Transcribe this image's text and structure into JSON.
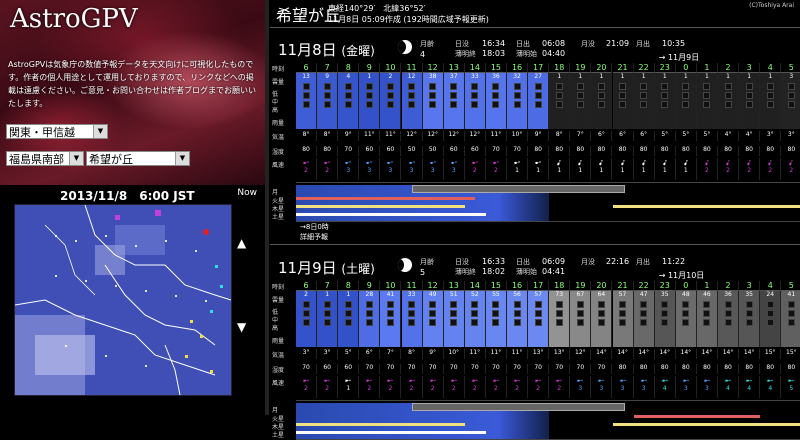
{
  "left": {
    "logo": "AstroGPV",
    "intro": "AstroGPVは気象庁の数値予報データを天文向けに可視化したものです。作者の個人用途として運用しておりますので、リンクなどへの掲載は遠慮ください。ご意見・お問い合わせは作者ブログまでお願いいたします。",
    "region_select": "関東・甲信越",
    "pref_select": "福島県南部",
    "site_select": "希望が丘",
    "map_time": "2013/11/8　6:00 JST",
    "now_label": "Now",
    "up_arrow": "▲",
    "down_arrow": "▼"
  },
  "header": {
    "site": "希望が丘",
    "coord": "東経140°29′　北緯36°52′",
    "made": "11月8日 05:09作成 (192時間広域予報更新)",
    "copyright": "(C)Toshiya Arai"
  },
  "row_labels": {
    "time": "時刻",
    "cloud_total": "雲量",
    "cloud_low": "低",
    "cloud_mid": "中",
    "cloud_high": "高",
    "rain": "雨量",
    "temp": "気温",
    "humidity": "湿度",
    "wind": "風速",
    "moon": "月",
    "mars": "火星",
    "jupiter": "木星",
    "saturn": "土星"
  },
  "days": [
    {
      "date": "11月8日",
      "dow": "(金曜)",
      "moon_age_label": "月齢",
      "moon_age": "4",
      "sunset_label": "日没",
      "sunset": "16:34",
      "civil_end_label": "薄明終",
      "civil_end": "18:03",
      "sunrise_label": "日出",
      "sunrise": "06:08",
      "civil_start_label": "薄明始",
      "civil_start": "04:40",
      "moonset_label": "月没",
      "moonset": "21:09",
      "moonrise_label": "月出",
      "moonrise": "10:35",
      "next_day": "11月9日",
      "hours": [
        "6",
        "7",
        "8",
        "9",
        "10",
        "11",
        "12",
        "13",
        "14",
        "15",
        "16",
        "17",
        "18",
        "19",
        "20",
        "21",
        "22",
        "23",
        "0",
        "1",
        "2",
        "3",
        "4",
        "5"
      ],
      "cloud": [
        "13",
        "9",
        "4",
        "1",
        "2",
        "12",
        "38",
        "37",
        "33",
        "36",
        "32",
        "27",
        "1",
        "1",
        "1",
        "1",
        "1",
        "1",
        "1",
        "1",
        "1",
        "1",
        "1",
        "3"
      ],
      "temp": [
        "8°",
        "8°",
        "9°",
        "11°",
        "11°",
        "12°",
        "12°",
        "12°",
        "12°",
        "11°",
        "10°",
        "9°",
        "8°",
        "7°",
        "6°",
        "6°",
        "6°",
        "5°",
        "5°",
        "5°",
        "4°",
        "4°",
        "3°",
        "3°"
      ],
      "hum": [
        "80",
        "80",
        "70",
        "60",
        "60",
        "50",
        "50",
        "60",
        "60",
        "70",
        "70",
        "80",
        "80",
        "80",
        "80",
        "80",
        "80",
        "80",
        "80",
        "80",
        "80",
        "80",
        "80",
        "80"
      ],
      "wind_speed": [
        "2",
        "2",
        "3",
        "3",
        "3",
        "3",
        "3",
        "3",
        "2",
        "2",
        "1",
        "1",
        "1",
        "1",
        "1",
        "1",
        "1",
        "1",
        "1",
        "2",
        "2",
        "2",
        "2",
        "2"
      ],
      "wind_color": [
        "#d23ad2",
        "#d23ad2",
        "#5aa0ff",
        "#5aa0ff",
        "#5aa0ff",
        "#5aa0ff",
        "#5aa0ff",
        "#5aa0ff",
        "#d23ad2",
        "#d23ad2",
        "#ffffff",
        "#ffffff",
        "#ffffff",
        "#ffffff",
        "#ffffff",
        "#ffffff",
        "#ffffff",
        "#ffffff",
        "#ffffff",
        "#d23ad2",
        "#d23ad2",
        "#d23ad2",
        "#d23ad2",
        "#d23ad2"
      ],
      "moon_note1": "→8日0時",
      "moon_note2": "詳細予報"
    },
    {
      "date": "11月9日",
      "dow": "(土曜)",
      "moon_age_label": "月齢",
      "moon_age": "5",
      "sunset_label": "日没",
      "sunset": "16:33",
      "civil_end_label": "薄明終",
      "civil_end": "18:02",
      "sunrise_label": "日出",
      "sunrise": "06:09",
      "civil_start_label": "薄明始",
      "civil_start": "04:41",
      "moonset_label": "月没",
      "moonset": "22:16",
      "moonrise_label": "月出",
      "moonrise": "11:22",
      "next_day": "11月10日",
      "hours": [
        "6",
        "7",
        "8",
        "9",
        "10",
        "11",
        "12",
        "13",
        "14",
        "15",
        "16",
        "17",
        "18",
        "19",
        "20",
        "21",
        "22",
        "23",
        "0",
        "1",
        "2",
        "3",
        "4",
        "5"
      ],
      "cloud": [
        "2",
        "1",
        "1",
        "28",
        "41",
        "33",
        "49",
        "51",
        "52",
        "55",
        "56",
        "57",
        "73",
        "67",
        "64",
        "57",
        "47",
        "35",
        "48",
        "46",
        "36",
        "35",
        "24",
        "41"
      ],
      "temp": [
        "3°",
        "3°",
        "5°",
        "6°",
        "7°",
        "8°",
        "9°",
        "10°",
        "11°",
        "11°",
        "11°",
        "13°",
        "13°",
        "12°",
        "14°",
        "14°",
        "14°",
        "14°",
        "14°",
        "14°",
        "14°",
        "14°",
        "15°",
        "15°"
      ],
      "hum": [
        "70",
        "60",
        "60",
        "70",
        "70",
        "70",
        "70",
        "70",
        "70",
        "70",
        "70",
        "70",
        "70",
        "70",
        "70",
        "80",
        "80",
        "80",
        "80",
        "80",
        "80",
        "80",
        "80",
        "80"
      ],
      "wind_speed": [
        "2",
        "2",
        "1",
        "2",
        "2",
        "2",
        "2",
        "2",
        "2",
        "2",
        "2",
        "2",
        "2",
        "3",
        "3",
        "3",
        "3",
        "4",
        "3",
        "3",
        "4",
        "4",
        "4",
        "5"
      ],
      "wind_color": [
        "#d23ad2",
        "#d23ad2",
        "#ffffff",
        "#d23ad2",
        "#d23ad2",
        "#d23ad2",
        "#d23ad2",
        "#d23ad2",
        "#d23ad2",
        "#d23ad2",
        "#d23ad2",
        "#d23ad2",
        "#d23ad2",
        "#5aa0ff",
        "#5aa0ff",
        "#5aa0ff",
        "#5aa0ff",
        "#30e0e0",
        "#5aa0ff",
        "#5aa0ff",
        "#30e0e0",
        "#30e0e0",
        "#30e0e0",
        "#30e0e0"
      ],
      "moon_note1": "",
      "moon_note2": ""
    }
  ],
  "colors": {
    "accent_green": "#8cff7a",
    "cell_blue": "#3e5bd6",
    "cell_gray": "#777777",
    "cell_dark": "#1c1c1c"
  }
}
